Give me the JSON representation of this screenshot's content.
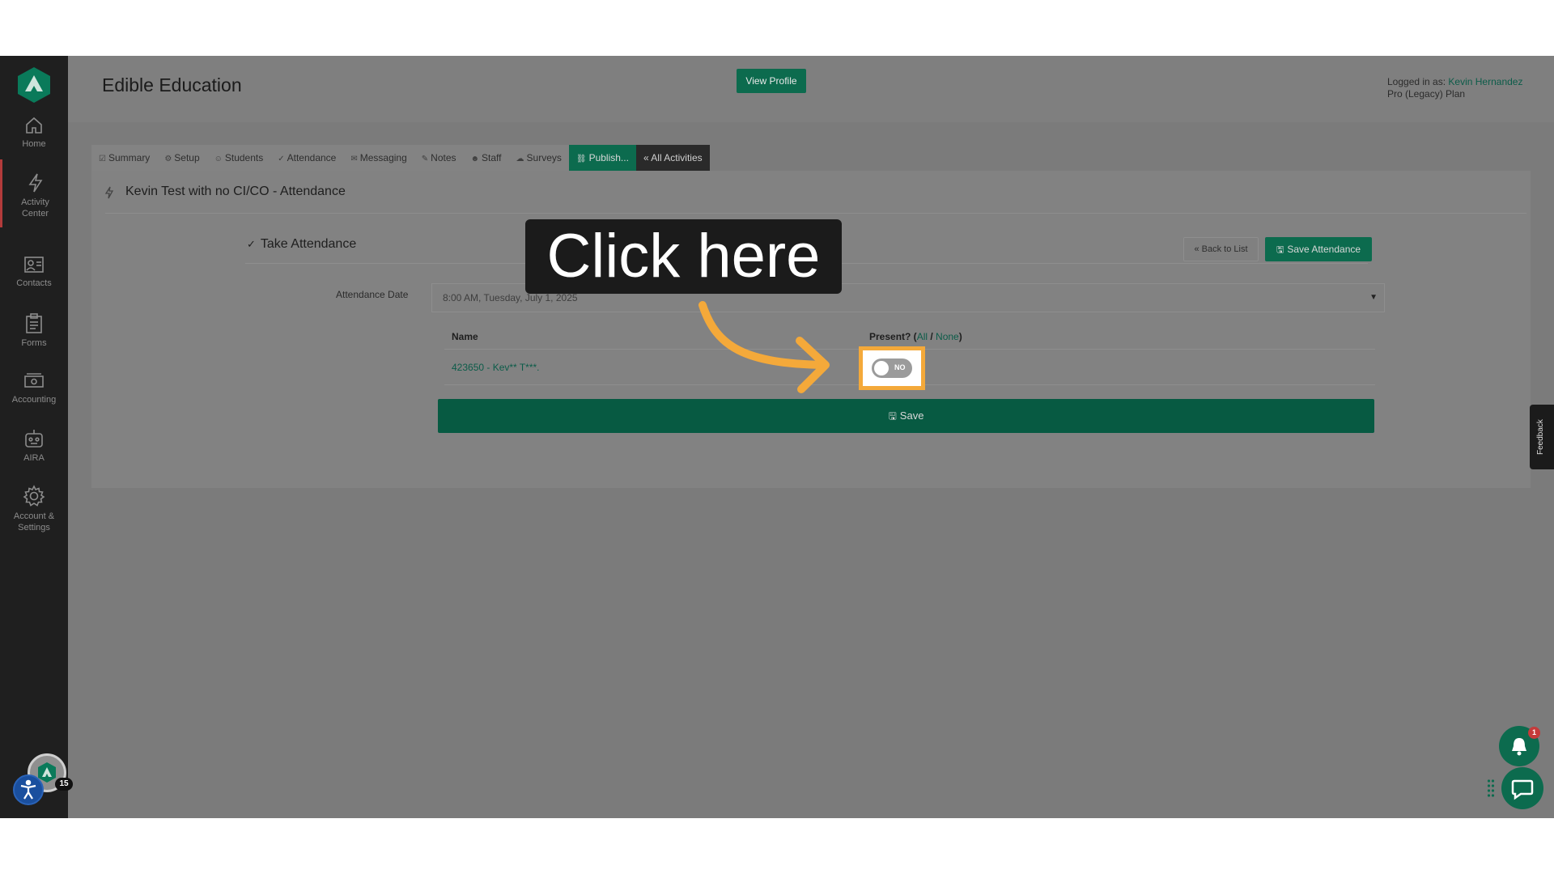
{
  "sidebar": {
    "items": [
      {
        "label": "Home",
        "icon": "home-icon"
      },
      {
        "label": "Activity Center",
        "icon": "bolt-icon"
      },
      {
        "label": "Contacts",
        "icon": "contacts-icon"
      },
      {
        "label": "Forms",
        "icon": "clipboard-icon"
      },
      {
        "label": "Accounting",
        "icon": "cash-icon"
      },
      {
        "label": "AIRA",
        "icon": "robot-icon"
      },
      {
        "label": "Account & Settings",
        "icon": "gear-icon"
      }
    ],
    "notification_count": "15"
  },
  "header": {
    "title": "Edible Education",
    "view_profile": "View Profile",
    "logged_in_label": "Logged in as:",
    "user_name": "Kevin Hernandez",
    "plan": "Pro (Legacy) Plan"
  },
  "tabs": [
    {
      "label": "Summary",
      "icon": "☑"
    },
    {
      "label": "Setup",
      "icon": "⚙"
    },
    {
      "label": "Students",
      "icon": "☺"
    },
    {
      "label": "Attendance",
      "icon": "✓"
    },
    {
      "label": "Messaging",
      "icon": "✉"
    },
    {
      "label": "Notes",
      "icon": "✎"
    },
    {
      "label": "Staff",
      "icon": "☻"
    },
    {
      "label": "Surveys",
      "icon": "☁"
    },
    {
      "label": "Publish...",
      "icon": "🔗"
    },
    {
      "label": "« All Activities",
      "icon": ""
    }
  ],
  "panel": {
    "title": "Kevin Test with no CI/CO - Attendance",
    "section_title": "Take Attendance",
    "back_to_list": "« Back to List",
    "save_attendance": "Save Attendance",
    "date_label": "Attendance Date",
    "date_value": "8:00 AM, Tuesday, July 1, 2025",
    "table": {
      "col_name": "Name",
      "col_present": "Present? (",
      "all_link": "All",
      "separator": " / ",
      "none_link": "None",
      "close_paren": ")",
      "rows": [
        {
          "student": "423650 - Kev** T***.",
          "present": "NO"
        }
      ]
    },
    "save_label": "Save"
  },
  "callout": "Click here",
  "feedback": "Feedback",
  "bell_badge": "1",
  "colors": {
    "accent_green": "#0c6b4e",
    "highlight_orange": "#f4a93a",
    "sidebar_bg": "#1f1f1f"
  }
}
